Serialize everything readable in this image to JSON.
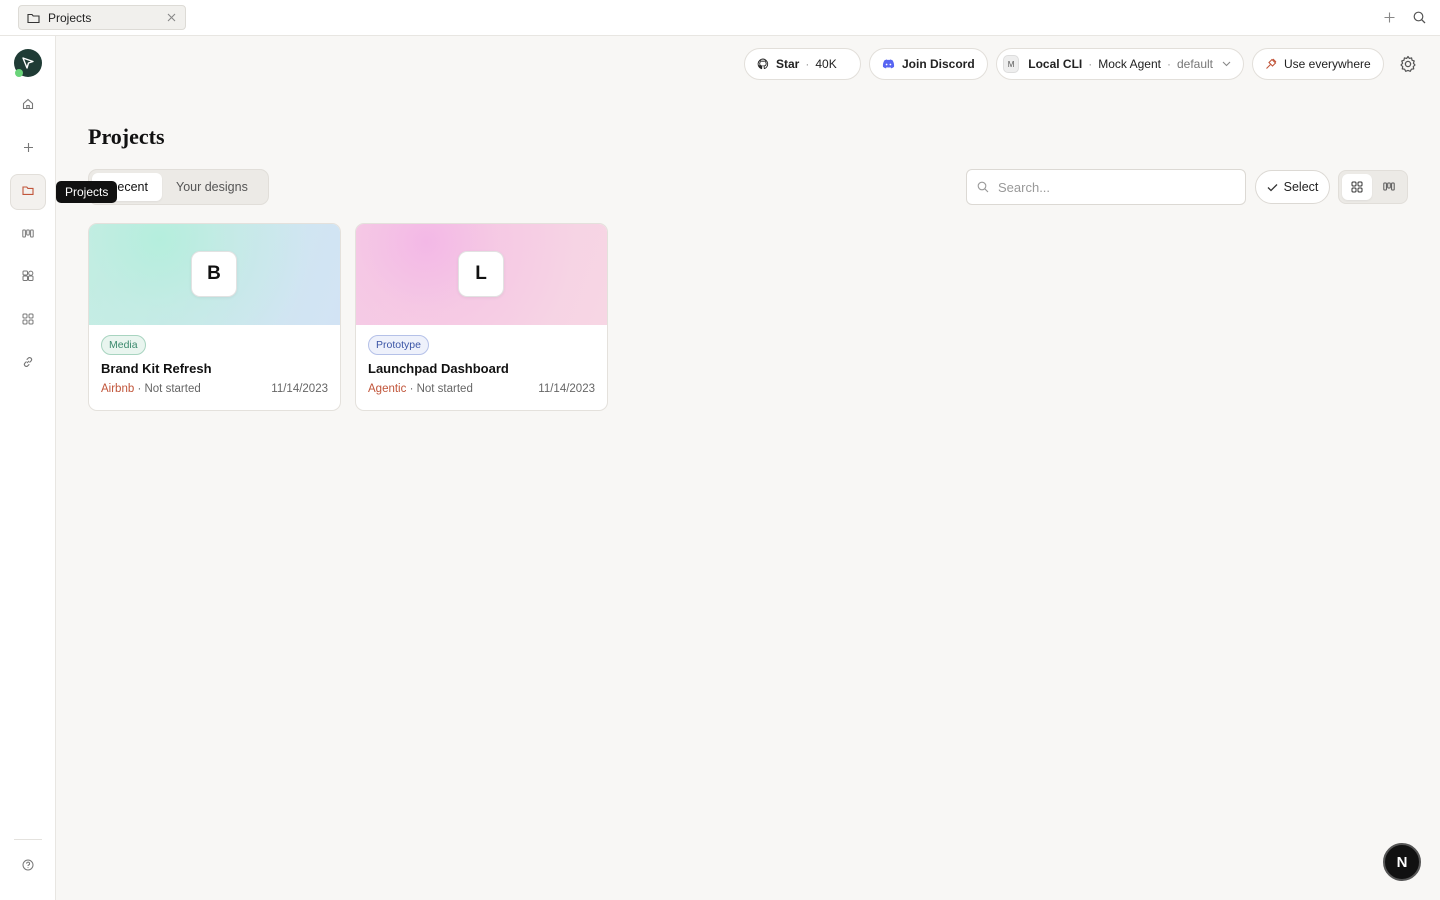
{
  "tab": {
    "label": "Projects"
  },
  "sidebar": {
    "tooltip": "Projects"
  },
  "header": {
    "star_label": "Star",
    "star_count": "40K",
    "discord_label": "Join Discord",
    "agent_source": "Local CLI",
    "agent_name": "Mock Agent",
    "agent_profile": "default",
    "agent_chip": "M",
    "use_everywhere": "Use everywhere"
  },
  "page": {
    "title": "Projects",
    "tabs": [
      "Recent",
      "Your designs"
    ],
    "tab_recent_visible": "ecent",
    "search_placeholder": "Search...",
    "select_label": "Select"
  },
  "projects": [
    {
      "letter": "B",
      "badge": "Media",
      "badge_color": "#3c8a6e",
      "title": "Brand Kit Refresh",
      "brand": "Airbnb",
      "status": "Not started",
      "date": "11/14/2023"
    },
    {
      "letter": "L",
      "badge": "Prototype",
      "badge_color": "#3b55a6",
      "title": "Launchpad Dashboard",
      "brand": "Agentic",
      "status": "Not started",
      "date": "11/14/2023"
    }
  ],
  "user": {
    "initial": "N"
  },
  "colors": {
    "brand_text": "#c1553a",
    "discord": "#5865f2",
    "use_everywhere_icon": "#c1553a"
  }
}
